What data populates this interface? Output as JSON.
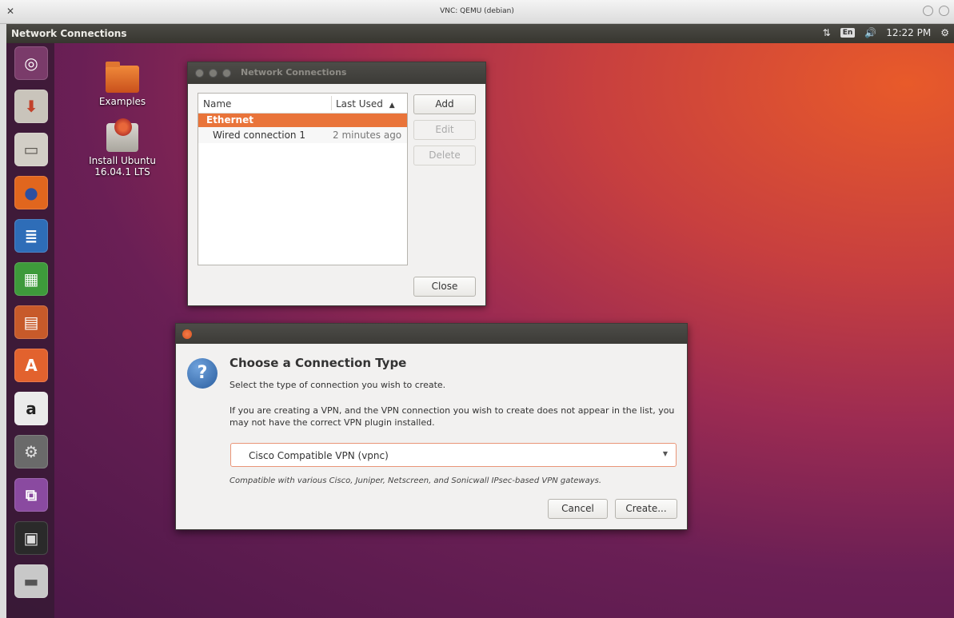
{
  "vnc": {
    "title": "VNC: QEMU (debian)",
    "left_icon": "✕"
  },
  "panel": {
    "app_title": "Network Connections",
    "network_symbol": "⇅",
    "keyboard_layout": "En",
    "volume_symbol": "🔊",
    "time": "12:22 PM",
    "settings_symbol": "⚙"
  },
  "launcher": {
    "items": [
      {
        "name": "dash-home-icon",
        "glyph": "◎",
        "bg": "#7a3b6a",
        "fg": "#ffffff"
      },
      {
        "name": "install-ubuntu-icon",
        "glyph": "⬇",
        "bg": "#c9c4bb",
        "fg": "#c2412a"
      },
      {
        "name": "files-icon",
        "glyph": "▭",
        "bg": "#d2cec6",
        "fg": "#5a5650"
      },
      {
        "name": "firefox-icon",
        "glyph": "●",
        "bg": "#e1661e",
        "fg": "#2c4fa0"
      },
      {
        "name": "writer-icon",
        "glyph": "≣",
        "bg": "#2e6db8",
        "fg": "#ffffff"
      },
      {
        "name": "calc-icon",
        "glyph": "▦",
        "bg": "#3e9a3b",
        "fg": "#ffffff"
      },
      {
        "name": "impress-icon",
        "glyph": "▤",
        "bg": "#c75a2a",
        "fg": "#ffffff"
      },
      {
        "name": "software-center-icon",
        "glyph": "A",
        "bg": "#e2622e",
        "fg": "#ffffff"
      },
      {
        "name": "amazon-icon",
        "glyph": "a",
        "bg": "#ebebeb",
        "fg": "#222222"
      },
      {
        "name": "system-settings-icon",
        "glyph": "⚙",
        "bg": "#6a6a6a",
        "fg": "#e0e0e0"
      },
      {
        "name": "network-connections-icon",
        "glyph": "⧉",
        "bg": "#8a4aa0",
        "fg": "#ffffff"
      },
      {
        "name": "save-disk-icon",
        "glyph": "▣",
        "bg": "#2a2a2a",
        "fg": "#dddddd"
      },
      {
        "name": "drive-icon",
        "glyph": "▬",
        "bg": "#c8c8c8",
        "fg": "#555555"
      }
    ]
  },
  "desktop": {
    "examples_label": "Examples",
    "install_label": "Install Ubuntu 16.04.1 LTS"
  },
  "nc_window": {
    "title": "Network Connections",
    "col_name": "Name",
    "col_last_used": "Last Used",
    "sort_glyph": "▲",
    "group": "Ethernet",
    "rows": [
      {
        "name": "Wired connection 1",
        "last_used": "2 minutes ago"
      }
    ],
    "add_label": "Add",
    "edit_label": "Edit",
    "delete_label": "Delete",
    "close_label": "Close"
  },
  "dialog": {
    "heading": "Choose a Connection Type",
    "subtitle": "Select the type of connection you wish to create.",
    "vpn_note": "If you are creating a VPN, and the VPN connection you wish to create does not appear in the list, you may not have the correct VPN plugin installed.",
    "selected_type": "Cisco Compatible VPN (vpnc)",
    "hint": "Compatible with various Cisco, Juniper, Netscreen, and Sonicwall IPsec-based VPN gateways.",
    "cancel_label": "Cancel",
    "create_label": "Create...",
    "question_glyph": "?"
  }
}
